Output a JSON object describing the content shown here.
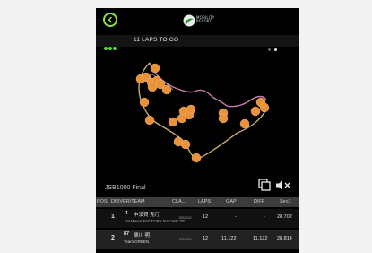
{
  "app": {
    "logo_text": "MOBILITY RESORT"
  },
  "status": {
    "laps_to_go": "11 LAPS TO GO",
    "page_dots": [
      {
        "active": false
      },
      {
        "active": true
      }
    ]
  },
  "race": {
    "title": "JSB1000 Final"
  },
  "table": {
    "headers": {
      "pos": "POS",
      "driver_team": "DRIVER/TEAM",
      "class": "CLA...",
      "laps": "LAPS",
      "gap": "GAP",
      "diff": "DIFF",
      "sec1": "Sec1"
    },
    "rows": [
      {
        "pos": "1",
        "car_no": "1",
        "driver": "中須賀 克行",
        "team": "YAMAHA FACTORY RACING TE...",
        "class": "JSB1000",
        "laps": "12",
        "gap": "-",
        "diff": "-",
        "sec1": "28.702"
      },
      {
        "pos": "2",
        "car_no": "87",
        "driver": "柳川 明",
        "team": "Team GREEN",
        "class": "JSB1000",
        "laps": "12",
        "gap": "11.122",
        "diff": "11.122",
        "sec1": "28.814"
      }
    ]
  },
  "colors": {
    "accent_green": "#8ee03a",
    "marker_orange": "#e8923a",
    "track_pink": "#c87aa8",
    "track_tan": "#c9a96a"
  }
}
